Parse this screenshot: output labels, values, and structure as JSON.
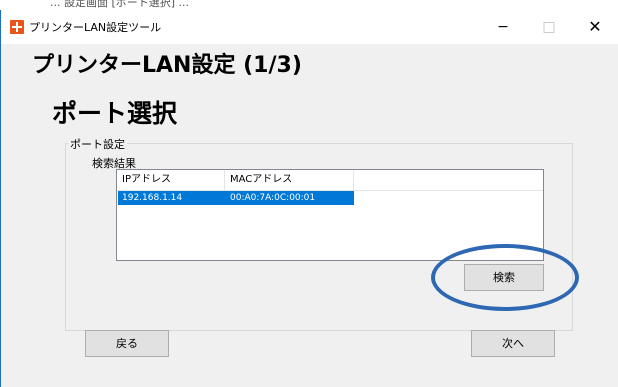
{
  "top_strip": {
    "text": "... 設定画面 [ポート選択] ..."
  },
  "window": {
    "title": "プリンターLAN設定ツール",
    "controls": {
      "minimize": "−",
      "maximize": "□",
      "close": "✕"
    }
  },
  "main": {
    "heading": "プリンターLAN設定 (1/3)",
    "subheading": "ポート選択"
  },
  "port_settings": {
    "group_label": "ポート設定",
    "results_label": "検索結果",
    "columns": [
      "IPアドレス",
      "MACアドレス"
    ],
    "rows": [
      {
        "ip": "192.168.1.14",
        "mac": "00:A0:7A:0C:00:01",
        "selected": true
      }
    ],
    "search_button": "検索"
  },
  "footer": {
    "back_button": "戻る",
    "next_button": "次へ"
  },
  "colors": {
    "selection": "#0078d7",
    "annotation_ellipse": "#2e68b3",
    "app_icon": "#e8541a"
  }
}
